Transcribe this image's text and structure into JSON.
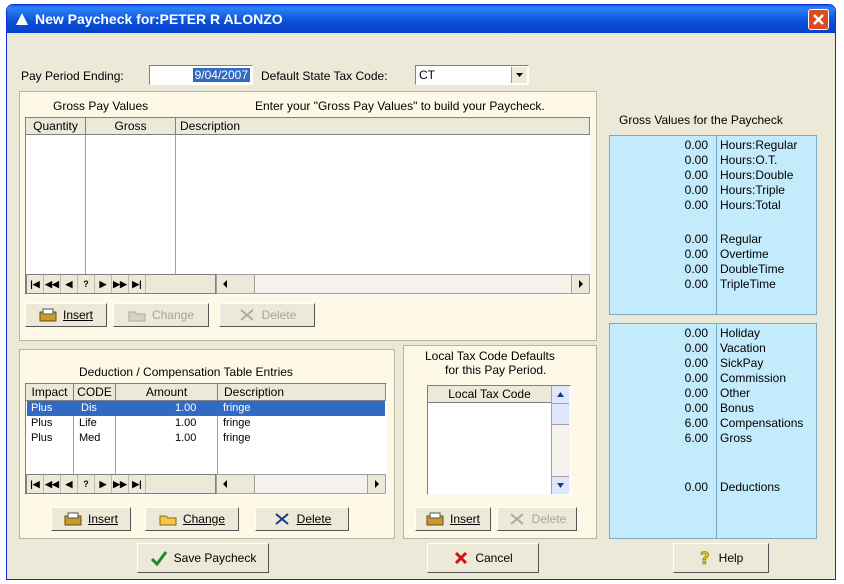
{
  "window": {
    "title": "New Paycheck for:PETER R ALONZO"
  },
  "pay_period": {
    "label": "Pay Period Ending:",
    "value": "9/04/2007"
  },
  "state_tax": {
    "label": "Default State Tax Code:",
    "value": "CT"
  },
  "gross_pay": {
    "title": "Gross Pay Values",
    "hint": "Enter your \"Gross Pay Values\" to build your Paycheck.",
    "columns": [
      "Quantity",
      "Gross",
      "Description"
    ],
    "nav_buttons": [
      "|◀",
      "◀◀",
      "◀",
      "?",
      "▶",
      "▶▶",
      "▶|"
    ],
    "insert": "Insert",
    "change": "Change",
    "delete": "Delete"
  },
  "deduction": {
    "title": "Deduction / Compensation Table Entries",
    "columns": [
      "Impact",
      "CODE",
      "Amount",
      "Description"
    ],
    "rows": [
      {
        "impact": "Plus",
        "code": "Dis",
        "amount": "1.00",
        "description": "fringe"
      },
      {
        "impact": "Plus",
        "code": "Life",
        "amount": "1.00",
        "description": "fringe"
      },
      {
        "impact": "Plus",
        "code": "Med",
        "amount": "1.00",
        "description": "fringe"
      }
    ],
    "nav_buttons": [
      "|◀",
      "◀◀",
      "◀",
      "?",
      "▶",
      "▶▶",
      "▶|"
    ],
    "insert": "Insert",
    "change": "Change",
    "delete": "Delete"
  },
  "local_tax": {
    "title_line1": "Local Tax Code Defaults",
    "title_line2": "for this Pay Period.",
    "column": "Local Tax Code",
    "insert": "Insert",
    "delete": "Delete"
  },
  "gross_values": {
    "title": "Gross Values for the Paycheck",
    "upper": [
      {
        "value": "0.00",
        "label": "Hours:Regular"
      },
      {
        "value": "0.00",
        "label": "Hours:O.T."
      },
      {
        "value": "0.00",
        "label": "Hours:Double"
      },
      {
        "value": "0.00",
        "label": "Hours:Triple"
      },
      {
        "value": "0.00",
        "label": "Hours:Total"
      },
      {
        "value": "0.00",
        "label": "Regular"
      },
      {
        "value": "0.00",
        "label": "Overtime"
      },
      {
        "value": "0.00",
        "label": "DoubleTime"
      },
      {
        "value": "0.00",
        "label": "TripleTime"
      }
    ],
    "lower": [
      {
        "value": "0.00",
        "label": "Holiday"
      },
      {
        "value": "0.00",
        "label": "Vacation"
      },
      {
        "value": "0.00",
        "label": "SickPay"
      },
      {
        "value": "0.00",
        "label": "Commission"
      },
      {
        "value": "0.00",
        "label": "Other"
      },
      {
        "value": "0.00",
        "label": "Bonus"
      },
      {
        "value": "6.00",
        "label": "Compensations"
      },
      {
        "value": "6.00",
        "label": "Gross"
      },
      {
        "value": "0.00",
        "label": "Deductions"
      }
    ]
  },
  "footer": {
    "save": "Save Paycheck",
    "cancel": "Cancel",
    "help": "Help"
  },
  "colors": {
    "title_bar": "#0a4fd8",
    "selection": "#316ac5",
    "gross_bg": "#c4ebfb",
    "panel_bg": "#fdf9e6"
  }
}
